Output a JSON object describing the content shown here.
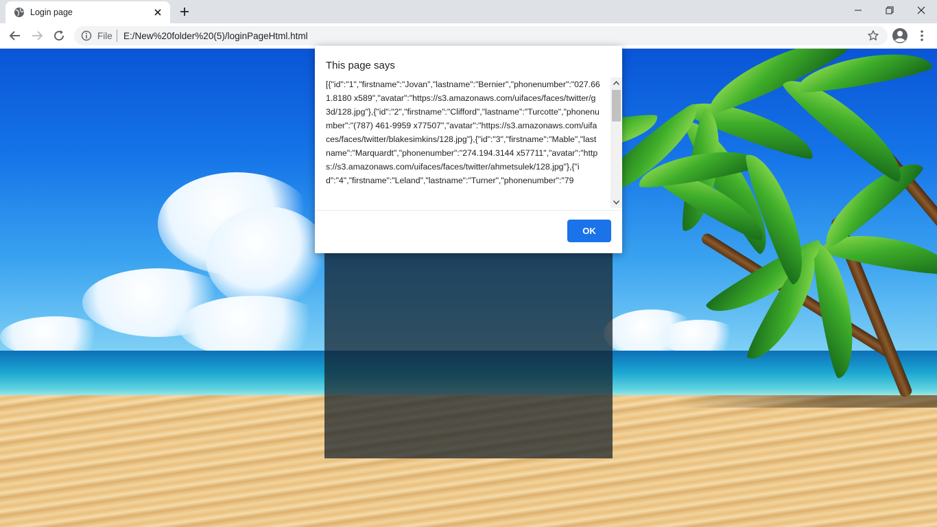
{
  "browser": {
    "tab_title": "Login page",
    "scheme_label": "File",
    "url": "E:/New%20folder%20(5)/loginPageHtml.html",
    "icons": {
      "tab_favicon": "globe-icon",
      "tab_close": "close-icon",
      "new_tab": "plus-icon",
      "minimize": "minimize-icon",
      "restore": "restore-icon",
      "close_window": "close-icon",
      "back": "back-arrow-icon",
      "forward": "forward-arrow-icon",
      "reload": "reload-icon",
      "site_info": "info-icon",
      "bookmark": "star-icon",
      "profile": "account-icon",
      "menu": "kebab-menu-icon"
    }
  },
  "dialog": {
    "title": "This page says",
    "message": "[{\"id\":\"1\",\"firstname\":\"Jovan\",\"lastname\":\"Bernier\",\"phonenumber\":\"027.661.8180 x589\",\"avatar\":\"https://s3.amazonaws.com/uifaces/faces/twitter/g3d/128.jpg\"},{\"id\":\"2\",\"firstname\":\"Clifford\",\"lastname\":\"Turcotte\",\"phonenumber\":\"(787) 461-9959 x77507\",\"avatar\":\"https://s3.amazonaws.com/uifaces/faces/twitter/blakesimkins/128.jpg\"},{\"id\":\"3\",\"firstname\":\"Mable\",\"lastname\":\"Marquardt\",\"phonenumber\":\"274.194.3144 x57711\",\"avatar\":\"https://s3.amazonaws.com/uifaces/faces/twitter/ahmetsulek/128.jpg\"},{\"id\":\"4\",\"firstname\":\"Leland\",\"lastname\":\"Turner\",\"phonenumber\":\"79",
    "ok_label": "OK",
    "accent_color": "#1a73e8"
  }
}
